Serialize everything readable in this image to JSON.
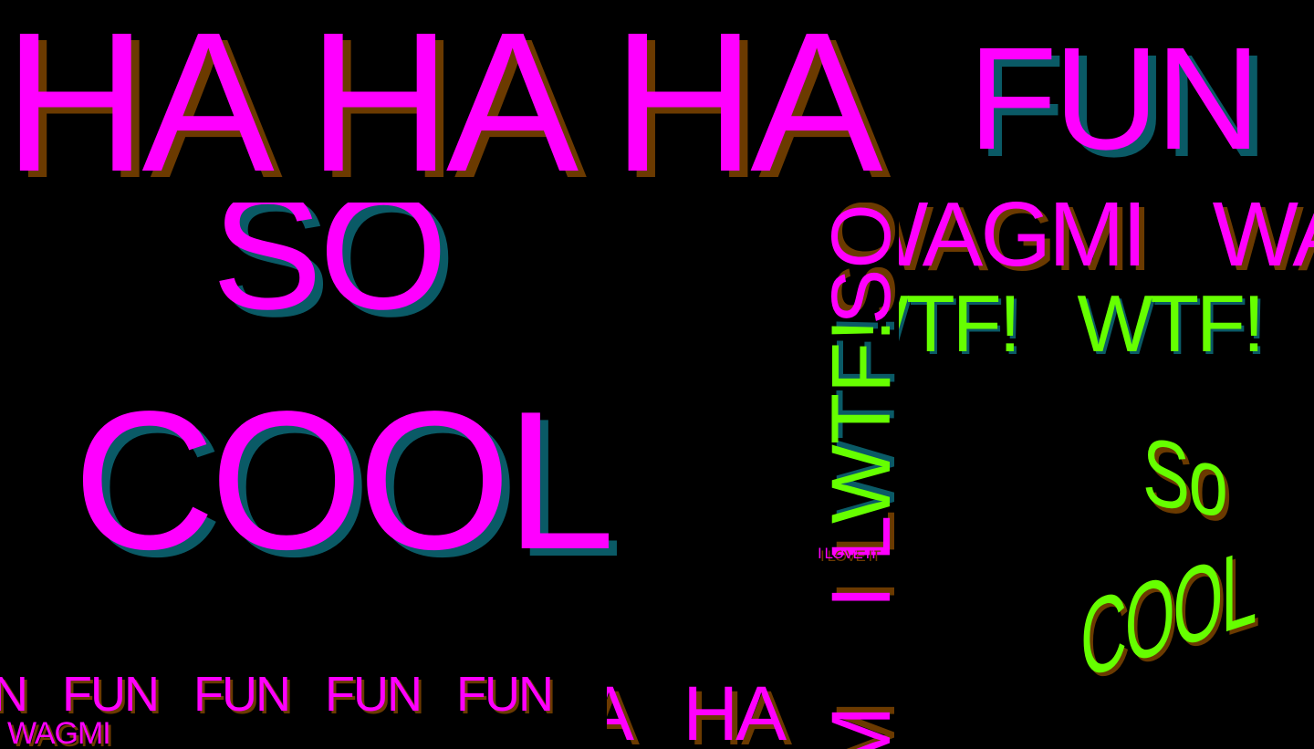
{
  "words": {
    "haha_row": "HA HA HA",
    "fun_big": "FUN",
    "so_big": "SO",
    "cool_big": "COOL",
    "wagmi_row": "WAGMI   WAGMI",
    "wtf_row": "WTF!   WTF!",
    "wtf_vertical": "WTF!",
    "so_vertical": "SO",
    "ily_vertical": "I L",
    "ily_small": "I LOVE IT",
    "so_green": "So",
    "cool_green": "COOL",
    "fun_row": "N   FUN   FUN   FUN   FUN",
    "wagmi_small": "WAGMI",
    "ha_bottom": "A   HA",
    "m_bottom": "M"
  },
  "colors": {
    "magenta": "#ff00ff",
    "green": "#66ff00",
    "brown_shadow": "#6b3a00",
    "teal_shadow": "#0a5a66",
    "background": "#000000"
  }
}
